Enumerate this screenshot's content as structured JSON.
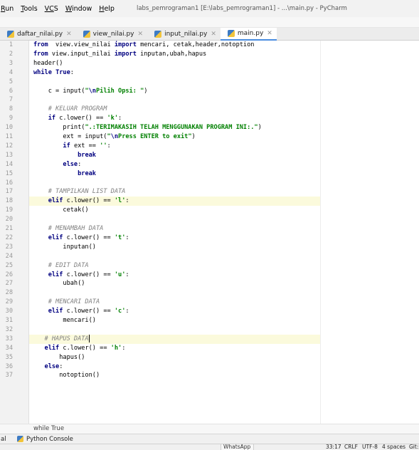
{
  "menu": {
    "items": [
      {
        "underlined": "R",
        "rest": "un",
        "label": "Run"
      },
      {
        "underlined": "T",
        "rest": "ools",
        "label": "Tools"
      },
      {
        "underlined": "VC",
        "rest": "S",
        "label": "VCS"
      },
      {
        "underlined": "W",
        "rest": "indow",
        "label": "Window"
      },
      {
        "underlined": "H",
        "rest": "elp",
        "label": "Help"
      }
    ],
    "window_title": "labs_pemrograman1 [E:\\labs_pemrograman1] - ...\\main.py - PyCharm"
  },
  "tabs": [
    {
      "label": "daftar_nilai.py",
      "active": false
    },
    {
      "label": "view_nilai.py",
      "active": false
    },
    {
      "label": "input_nilai.py",
      "active": false
    },
    {
      "label": "main.py",
      "active": true
    }
  ],
  "code_lines": [
    {
      "n": "1",
      "tokens": [
        [
          "kw",
          "from"
        ],
        [
          "",
          "  view.view_nilai "
        ],
        [
          "kw",
          "import"
        ],
        [
          "",
          " mencari, cetak,header,notoption"
        ]
      ]
    },
    {
      "n": "2",
      "tokens": [
        [
          "kw",
          "from"
        ],
        [
          "",
          " view.input_nilai "
        ],
        [
          "kw",
          "import"
        ],
        [
          "",
          " inputan,ubah,hapus"
        ]
      ]
    },
    {
      "n": "3",
      "tokens": [
        [
          "",
          "header()"
        ]
      ]
    },
    {
      "n": "4",
      "tokens": [
        [
          "kw",
          "while"
        ],
        [
          "",
          " "
        ],
        [
          "kw",
          "True"
        ],
        [
          "",
          ":"
        ]
      ]
    },
    {
      "n": "5",
      "tokens": []
    },
    {
      "n": "6",
      "tokens": [
        [
          "",
          "    c = input("
        ],
        [
          "str",
          "\""
        ],
        [
          "esc",
          "\\n"
        ],
        [
          "str",
          "Pilih Opsi: \""
        ],
        [
          "",
          ")"
        ]
      ]
    },
    {
      "n": "7",
      "tokens": []
    },
    {
      "n": "8",
      "tokens": [
        [
          "cm",
          "    # KELUAR PROGRAM"
        ]
      ]
    },
    {
      "n": "9",
      "tokens": [
        [
          "",
          "    "
        ],
        [
          "kw",
          "if"
        ],
        [
          "",
          " c.lower() == "
        ],
        [
          "str",
          "'k'"
        ],
        [
          "",
          ":"
        ]
      ]
    },
    {
      "n": "10",
      "tokens": [
        [
          "",
          "        print("
        ],
        [
          "str",
          "\".:TERIMAKASIH TELAH MENGGUNAKAN PROGRAM INI:.\""
        ],
        [
          "",
          ")"
        ]
      ]
    },
    {
      "n": "11",
      "tokens": [
        [
          "",
          "        ext = input("
        ],
        [
          "str",
          "\""
        ],
        [
          "esc",
          "\\n"
        ],
        [
          "str",
          "Press ENTER to exit\""
        ],
        [
          "",
          ")"
        ]
      ]
    },
    {
      "n": "12",
      "tokens": [
        [
          "",
          "        "
        ],
        [
          "kw",
          "if"
        ],
        [
          "",
          " ext == "
        ],
        [
          "str",
          "''"
        ],
        [
          "",
          ":"
        ]
      ]
    },
    {
      "n": "13",
      "tokens": [
        [
          "",
          "            "
        ],
        [
          "kw",
          "break"
        ]
      ]
    },
    {
      "n": "14",
      "tokens": [
        [
          "",
          "        "
        ],
        [
          "kw",
          "else"
        ],
        [
          "",
          ":"
        ]
      ]
    },
    {
      "n": "15",
      "tokens": [
        [
          "",
          "            "
        ],
        [
          "kw",
          "break"
        ]
      ]
    },
    {
      "n": "16",
      "tokens": []
    },
    {
      "n": "17",
      "tokens": [
        [
          "cm",
          "    # TAMPILKAN LIST DATA"
        ]
      ]
    },
    {
      "n": "18",
      "tokens": [
        [
          "",
          "    "
        ],
        [
          "kw",
          "elif"
        ],
        [
          "",
          " c.lower() == "
        ],
        [
          "str",
          "'l'"
        ],
        [
          "",
          ":"
        ]
      ],
      "highlight": true
    },
    {
      "n": "19",
      "tokens": [
        [
          "",
          "        cetak()"
        ]
      ]
    },
    {
      "n": "20",
      "tokens": []
    },
    {
      "n": "21",
      "tokens": [
        [
          "cm",
          "    # MENAMBAH DATA"
        ]
      ]
    },
    {
      "n": "22",
      "tokens": [
        [
          "",
          "    "
        ],
        [
          "kw",
          "elif"
        ],
        [
          "",
          " c.lower() == "
        ],
        [
          "str",
          "'t'"
        ],
        [
          "",
          ":"
        ]
      ]
    },
    {
      "n": "23",
      "tokens": [
        [
          "",
          "        inputan()"
        ]
      ]
    },
    {
      "n": "24",
      "tokens": []
    },
    {
      "n": "25",
      "tokens": [
        [
          "cm",
          "    # EDIT DATA"
        ]
      ]
    },
    {
      "n": "26",
      "tokens": [
        [
          "",
          "    "
        ],
        [
          "kw",
          "elif"
        ],
        [
          "",
          " c.lower() == "
        ],
        [
          "str",
          "'u'"
        ],
        [
          "",
          ":"
        ]
      ]
    },
    {
      "n": "27",
      "tokens": [
        [
          "",
          "        ubah()"
        ]
      ]
    },
    {
      "n": "28",
      "tokens": []
    },
    {
      "n": "29",
      "tokens": [
        [
          "cm",
          "    # MENCARI DATA"
        ]
      ]
    },
    {
      "n": "30",
      "tokens": [
        [
          "",
          "    "
        ],
        [
          "kw",
          "elif"
        ],
        [
          "",
          " c.lower() == "
        ],
        [
          "str",
          "'c'"
        ],
        [
          "",
          ":"
        ]
      ]
    },
    {
      "n": "31",
      "tokens": [
        [
          "",
          "        mencari()"
        ]
      ]
    },
    {
      "n": "32",
      "tokens": []
    },
    {
      "n": "33",
      "tokens": [
        [
          "cm",
          "   # HAPUS DATA"
        ]
      ],
      "highlight": true,
      "caret": true
    },
    {
      "n": "34",
      "tokens": [
        [
          "",
          "   "
        ],
        [
          "kw",
          "elif"
        ],
        [
          "",
          " c.lower() == "
        ],
        [
          "str",
          "'h'"
        ],
        [
          "",
          ":"
        ]
      ]
    },
    {
      "n": "35",
      "tokens": [
        [
          "",
          "       hapus()"
        ]
      ]
    },
    {
      "n": "36",
      "tokens": [
        [
          "",
          "   "
        ],
        [
          "kw",
          "else"
        ],
        [
          "",
          ":"
        ]
      ]
    },
    {
      "n": "37",
      "tokens": [
        [
          "",
          "       notoption()"
        ]
      ]
    }
  ],
  "breadcrumb": "while True",
  "tool_windows": {
    "cut_label": "al",
    "python_console": "Python Console"
  },
  "taskbar": {
    "whatsapp": "WhatsApp"
  },
  "status": {
    "position": "33:17",
    "line_sep": "CRLF",
    "encoding": "UTF-8",
    "indent": "4 spaces",
    "vcs": "Git:"
  },
  "colors": {
    "keyword": "#000080",
    "string": "#008000",
    "comment": "#808080",
    "caret_row": "#fbfadc",
    "active_tab_underline": "#4a8de0"
  }
}
